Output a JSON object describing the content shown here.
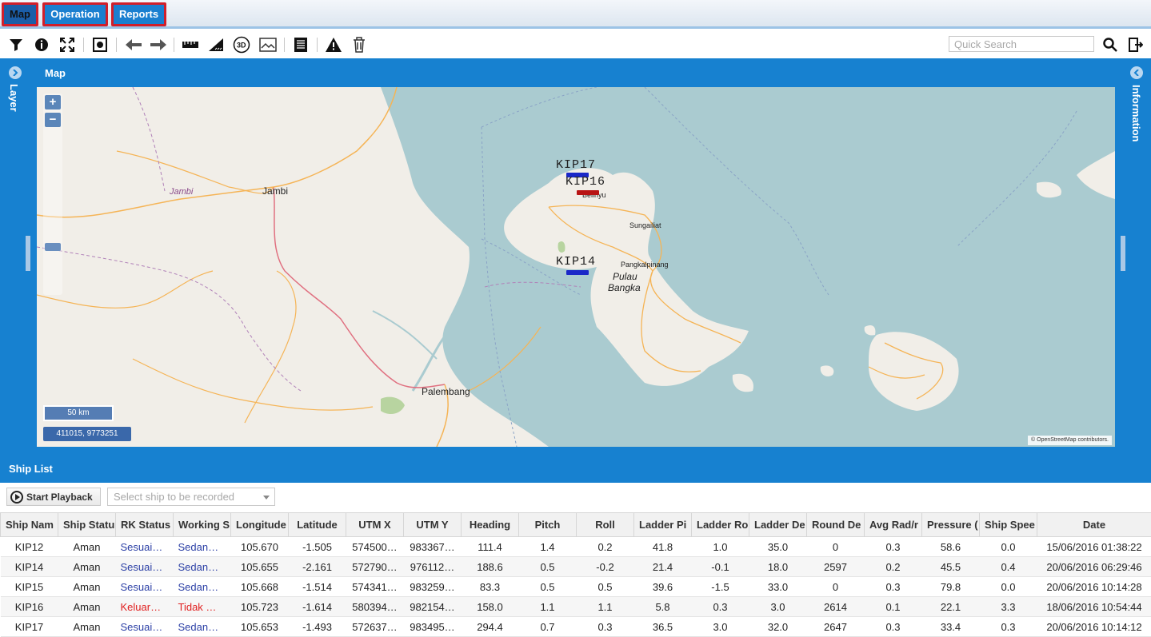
{
  "menu": {
    "tabs": [
      {
        "label": "Map",
        "active": true
      },
      {
        "label": "Operation",
        "active": false
      },
      {
        "label": "Reports",
        "active": false
      }
    ]
  },
  "toolbar": {
    "icons": [
      "filter-icon",
      "info-icon",
      "fullscreen-icon",
      "zoom-extent-icon",
      "back-arrow-icon",
      "forward-arrow-icon",
      "ruler-icon",
      "area-measure-icon",
      "3d-icon",
      "image-icon",
      "document-icon",
      "warning-icon",
      "trash-icon"
    ],
    "search_placeholder": "Quick Search"
  },
  "map": {
    "title": "Map",
    "left_panel_label": "Layer",
    "right_panel_label": "Information",
    "zoom_in": "+",
    "zoom_out": "−",
    "scale": "50 km",
    "coordinates": "411015, 9773251",
    "attribution": "© OpenStreetMap contributors.",
    "places": {
      "jambi_region": "Jambi",
      "jambi_city": "Jambi",
      "palembang": "Palembang",
      "belinyu": "Belinyu",
      "sungailiat": "Sungailiat",
      "pangkalpinang": "Pangkalpinang",
      "pulau": "Pulau",
      "bangka": "Bangka"
    },
    "ships": [
      {
        "label": "KIP17",
        "color": "#1a28c8"
      },
      {
        "label": "KIP16",
        "color": "#b81414"
      },
      {
        "label": "KIP14",
        "color": "#1a28c8"
      }
    ],
    "colors": {
      "sea": "#aacbd0",
      "land": "#f1eee8",
      "road": "#f5b456",
      "border": "#b080b8"
    }
  },
  "ship_list": {
    "title": "Ship List",
    "playback_label": "Start Playback",
    "select_placeholder": "Select ship to be recorded",
    "columns": [
      "Ship Nam",
      "Ship Statu",
      "RK Status",
      "Working S",
      "Longitude",
      "Latitude",
      "UTM X",
      "UTM Y",
      "Heading",
      "Pitch",
      "Roll",
      "Ladder Pi",
      "Ladder Ro",
      "Ladder De",
      "Round De",
      "Avg Rad/r",
      "Pressure (",
      "Ship Spee",
      "Date"
    ],
    "rows": [
      {
        "name": "KIP12",
        "status": "Aman",
        "rk": "Sesuai…",
        "working": "Sedan…",
        "lon": "105.670",
        "lat": "-1.505",
        "utmx": "574500…",
        "utmy": "983367…",
        "heading": "111.4",
        "pitch": "1.4",
        "roll": "0.2",
        "ladder_pi": "41.8",
        "ladder_ro": "1.0",
        "ladder_de": "35.0",
        "round_de": "0",
        "avg_rad": "0.3",
        "pressure": "58.6",
        "speed": "0.0",
        "date": "15/06/2016 01:38:22",
        "alert": false
      },
      {
        "name": "KIP14",
        "status": "Aman",
        "rk": "Sesuai…",
        "working": "Sedan…",
        "lon": "105.655",
        "lat": "-2.161",
        "utmx": "572790…",
        "utmy": "976112…",
        "heading": "188.6",
        "pitch": "0.5",
        "roll": "-0.2",
        "ladder_pi": "21.4",
        "ladder_ro": "-0.1",
        "ladder_de": "18.0",
        "round_de": "2597",
        "avg_rad": "0.2",
        "pressure": "45.5",
        "speed": "0.4",
        "date": "20/06/2016 06:29:46",
        "alert": false
      },
      {
        "name": "KIP15",
        "status": "Aman",
        "rk": "Sesuai…",
        "working": "Sedan…",
        "lon": "105.668",
        "lat": "-1.514",
        "utmx": "574341…",
        "utmy": "983259…",
        "heading": "83.3",
        "pitch": "0.5",
        "roll": "0.5",
        "ladder_pi": "39.6",
        "ladder_ro": "-1.5",
        "ladder_de": "33.0",
        "round_de": "0",
        "avg_rad": "0.3",
        "pressure": "79.8",
        "speed": "0.0",
        "date": "20/06/2016 10:14:28",
        "alert": false
      },
      {
        "name": "KIP16",
        "status": "Aman",
        "rk": "Keluar…",
        "working": "Tidak …",
        "lon": "105.723",
        "lat": "-1.614",
        "utmx": "580394…",
        "utmy": "982154…",
        "heading": "158.0",
        "pitch": "1.1",
        "roll": "1.1",
        "ladder_pi": "5.8",
        "ladder_ro": "0.3",
        "ladder_de": "3.0",
        "round_de": "2614",
        "avg_rad": "0.1",
        "pressure": "22.1",
        "speed": "3.3",
        "date": "18/06/2016 10:54:44",
        "alert": true
      },
      {
        "name": "KIP17",
        "status": "Aman",
        "rk": "Sesuai…",
        "working": "Sedan…",
        "lon": "105.653",
        "lat": "-1.493",
        "utmx": "572637…",
        "utmy": "983495…",
        "heading": "294.4",
        "pitch": "0.7",
        "roll": "0.3",
        "ladder_pi": "36.5",
        "ladder_ro": "3.0",
        "ladder_de": "32.0",
        "round_de": "2647",
        "avg_rad": "0.3",
        "pressure": "33.4",
        "speed": "0.3",
        "date": "20/06/2016 10:14:12",
        "alert": false
      }
    ]
  }
}
